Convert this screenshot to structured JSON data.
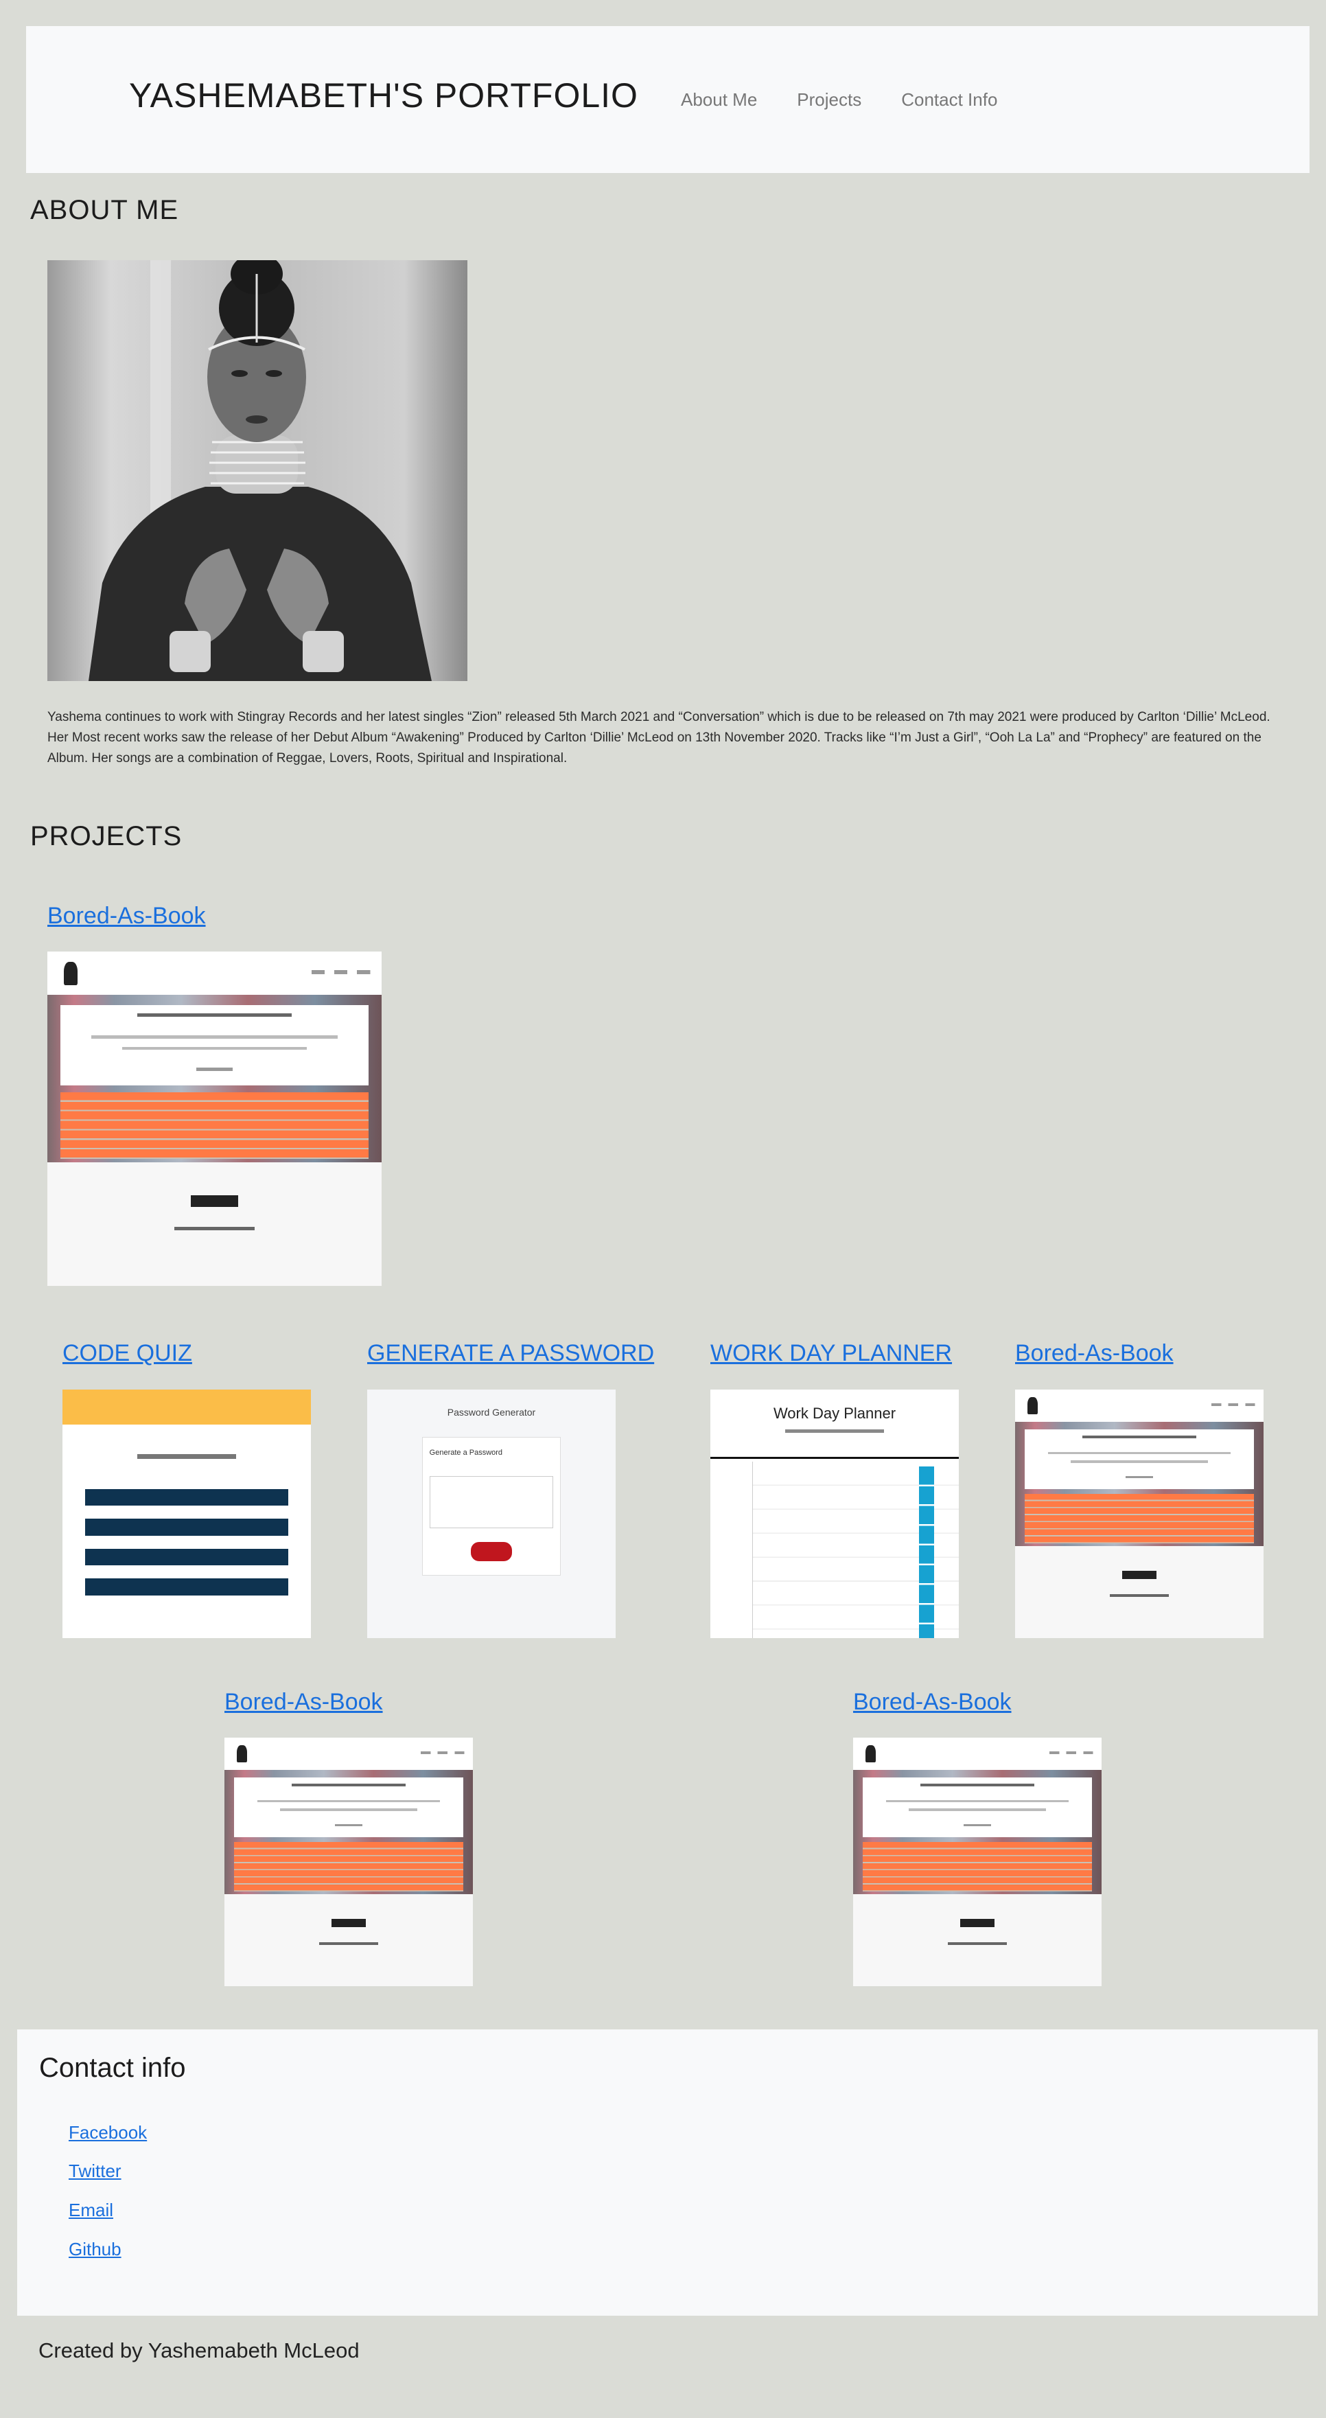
{
  "header": {
    "title": "YASHEMABETH'S PORTFOLIO",
    "nav": [
      "About Me",
      "Projects",
      "Contact Info"
    ]
  },
  "about": {
    "heading": "ABOUT ME",
    "bio": "Yashema continues to work with Stingray Records and her latest singles “Zion” released 5th March 2021 and “Conversation” which is due to be released on 7th may 2021 were produced by Carlton ‘Dillie’ McLeod. Her Most recent works saw the release of her Debut Album “Awakening” Produced by Carlton ‘Dillie’ McLeod on 13th November 2020. Tracks like “I’m Just a Girl”, “Ooh La La” and “Prophecy” are featured on the Album. Her songs are a combination of Reggae, Lovers, Roots, Spiritual and Inspirational."
  },
  "projects": {
    "heading": "PROJECTS",
    "featured": "Bored-As-Book",
    "row1": [
      "CODE QUIZ",
      "GENERATE A PASSWORD",
      "WORK DAY PLANNER",
      "Bored-As-Book"
    ],
    "row2": [
      "Bored-As-Book",
      "Bored-As-Book"
    ],
    "mock": {
      "password_title": "Password Generator",
      "password_card": "Generate a Password",
      "planner_title": "Work Day Planner",
      "bored_footer": "BORED AS"
    }
  },
  "contact": {
    "heading": "Contact info",
    "links": [
      "Facebook",
      "Twitter",
      "Email",
      "Github"
    ]
  },
  "footer": {
    "text": "Created by Yashemabeth McLeod"
  },
  "colors": {
    "page_bg": "#dadcd6",
    "panel_bg": "#f8f9fa",
    "link": "#1a6fdd",
    "accent_orange": "#ff7a45"
  }
}
